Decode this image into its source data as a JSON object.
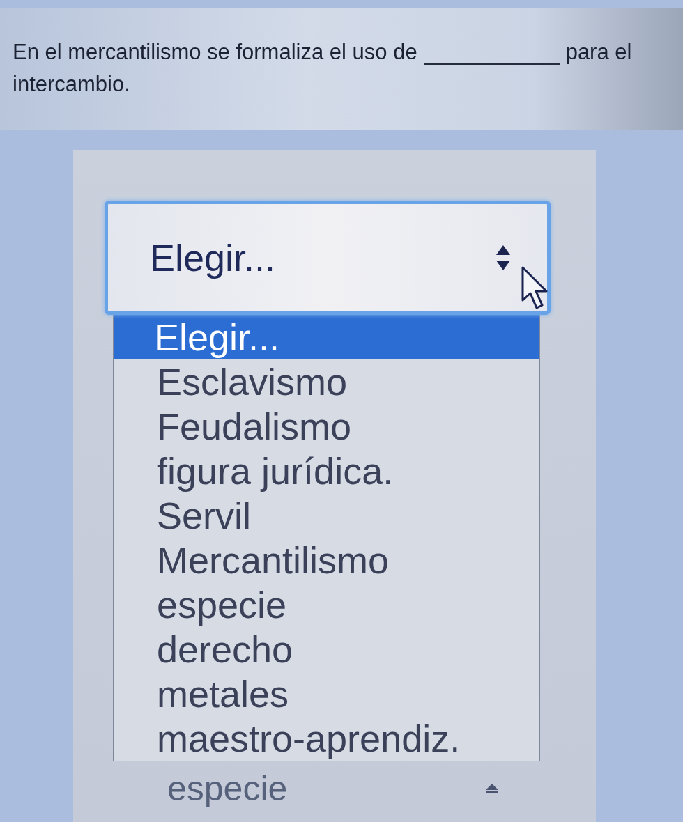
{
  "question": {
    "text_before": "En el mercantilismo se formaliza el uso de",
    "text_after": "para el intercambio."
  },
  "select": {
    "value": "Elegir...",
    "expanded": true,
    "options": [
      {
        "label": "Elegir...",
        "selected": true
      },
      {
        "label": "Esclavismo",
        "selected": false
      },
      {
        "label": "Feudalismo",
        "selected": false
      },
      {
        "label": "figura jurídica.",
        "selected": false
      },
      {
        "label": "Servil",
        "selected": false
      },
      {
        "label": "Mercantilismo",
        "selected": false
      },
      {
        "label": "especie",
        "selected": false
      },
      {
        "label": "derecho",
        "selected": false
      },
      {
        "label": "metales",
        "selected": false
      },
      {
        "label": "maestro-aprendiz.",
        "selected": false
      }
    ]
  },
  "next_select": {
    "value": "especie"
  }
}
